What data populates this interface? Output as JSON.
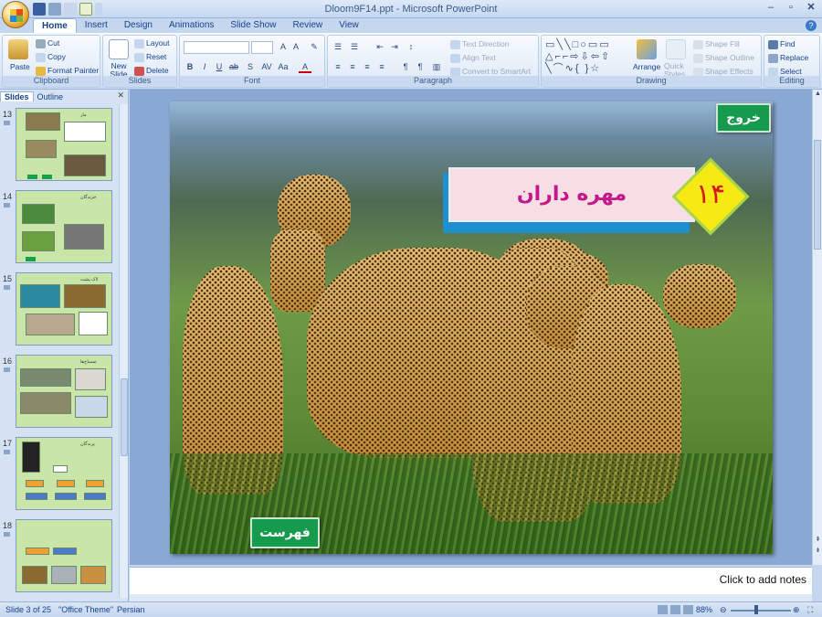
{
  "window": {
    "title": "Dloom9F14.ppt - Microsoft PowerPoint"
  },
  "ribbon_tabs": [
    "Home",
    "Insert",
    "Design",
    "Animations",
    "Slide Show",
    "Review",
    "View"
  ],
  "clipboard": {
    "paste": "Paste",
    "cut": "Cut",
    "copy": "Copy",
    "format_painter": "Format Painter",
    "label": "Clipboard"
  },
  "slides_group": {
    "new_slide": "New Slide",
    "layout": "Layout",
    "reset": "Reset",
    "delete": "Delete",
    "label": "Slides"
  },
  "font_group": {
    "label": "Font"
  },
  "paragraph_group": {
    "text_direction": "Text Direction",
    "align_text": "Align Text",
    "convert_smartart": "Convert to SmartArt",
    "label": "Paragraph"
  },
  "drawing_group": {
    "arrange": "Arrange",
    "quick_styles": "Quick Styles",
    "shape_fill": "Shape Fill",
    "shape_outline": "Shape Outline",
    "shape_effects": "Shape Effects",
    "label": "Drawing"
  },
  "editing_group": {
    "find": "Find",
    "replace": "Replace",
    "select": "Select",
    "label": "Editing"
  },
  "left_panel": {
    "tabs": [
      "Slides",
      "Outline"
    ],
    "thumbnails": [
      {
        "number": "13",
        "title": "مار"
      },
      {
        "number": "14",
        "title": "خزندگان"
      },
      {
        "number": "15",
        "title": "لاک پشت"
      },
      {
        "number": "16",
        "title": "تمساح‌ها"
      },
      {
        "number": "17",
        "title": "پرندگان"
      },
      {
        "number": "18",
        "title": ""
      }
    ]
  },
  "slide": {
    "title": "مهره داران",
    "number": "۱۴",
    "exit_button": "خروج",
    "index_button": "فهرست"
  },
  "notes": {
    "placeholder": "Click to add notes"
  },
  "status": {
    "slide_info": "Slide 3 of 25",
    "theme": "\"Office Theme\"",
    "language": "Persian",
    "zoom": "88%"
  }
}
